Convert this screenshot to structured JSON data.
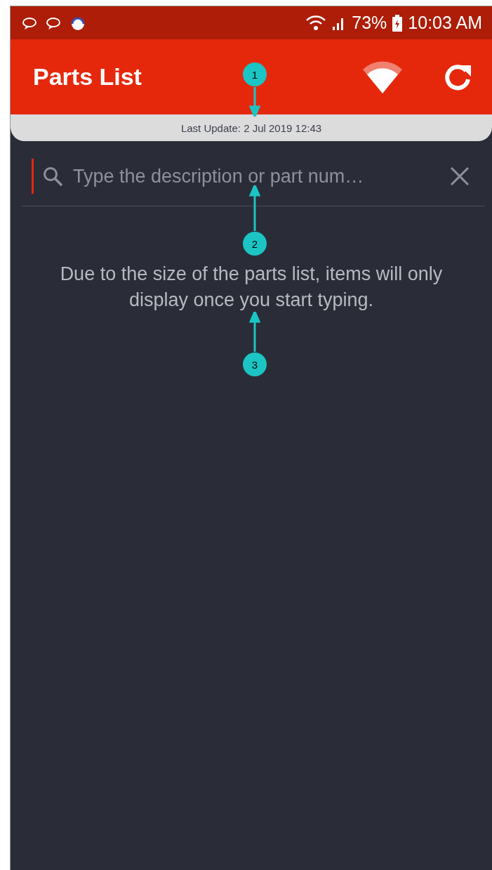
{
  "status_bar": {
    "battery": "73%",
    "time": "10:03 AM"
  },
  "app_bar": {
    "title": "Parts List"
  },
  "last_update": "Last Update: 2 Jul 2019 12:43",
  "search": {
    "placeholder": "Type the description or part num…"
  },
  "message": "Due to the size of the parts list, items will only display once you start typing.",
  "callouts": [
    {
      "label": "1"
    },
    {
      "label": "2"
    },
    {
      "label": "3"
    }
  ]
}
